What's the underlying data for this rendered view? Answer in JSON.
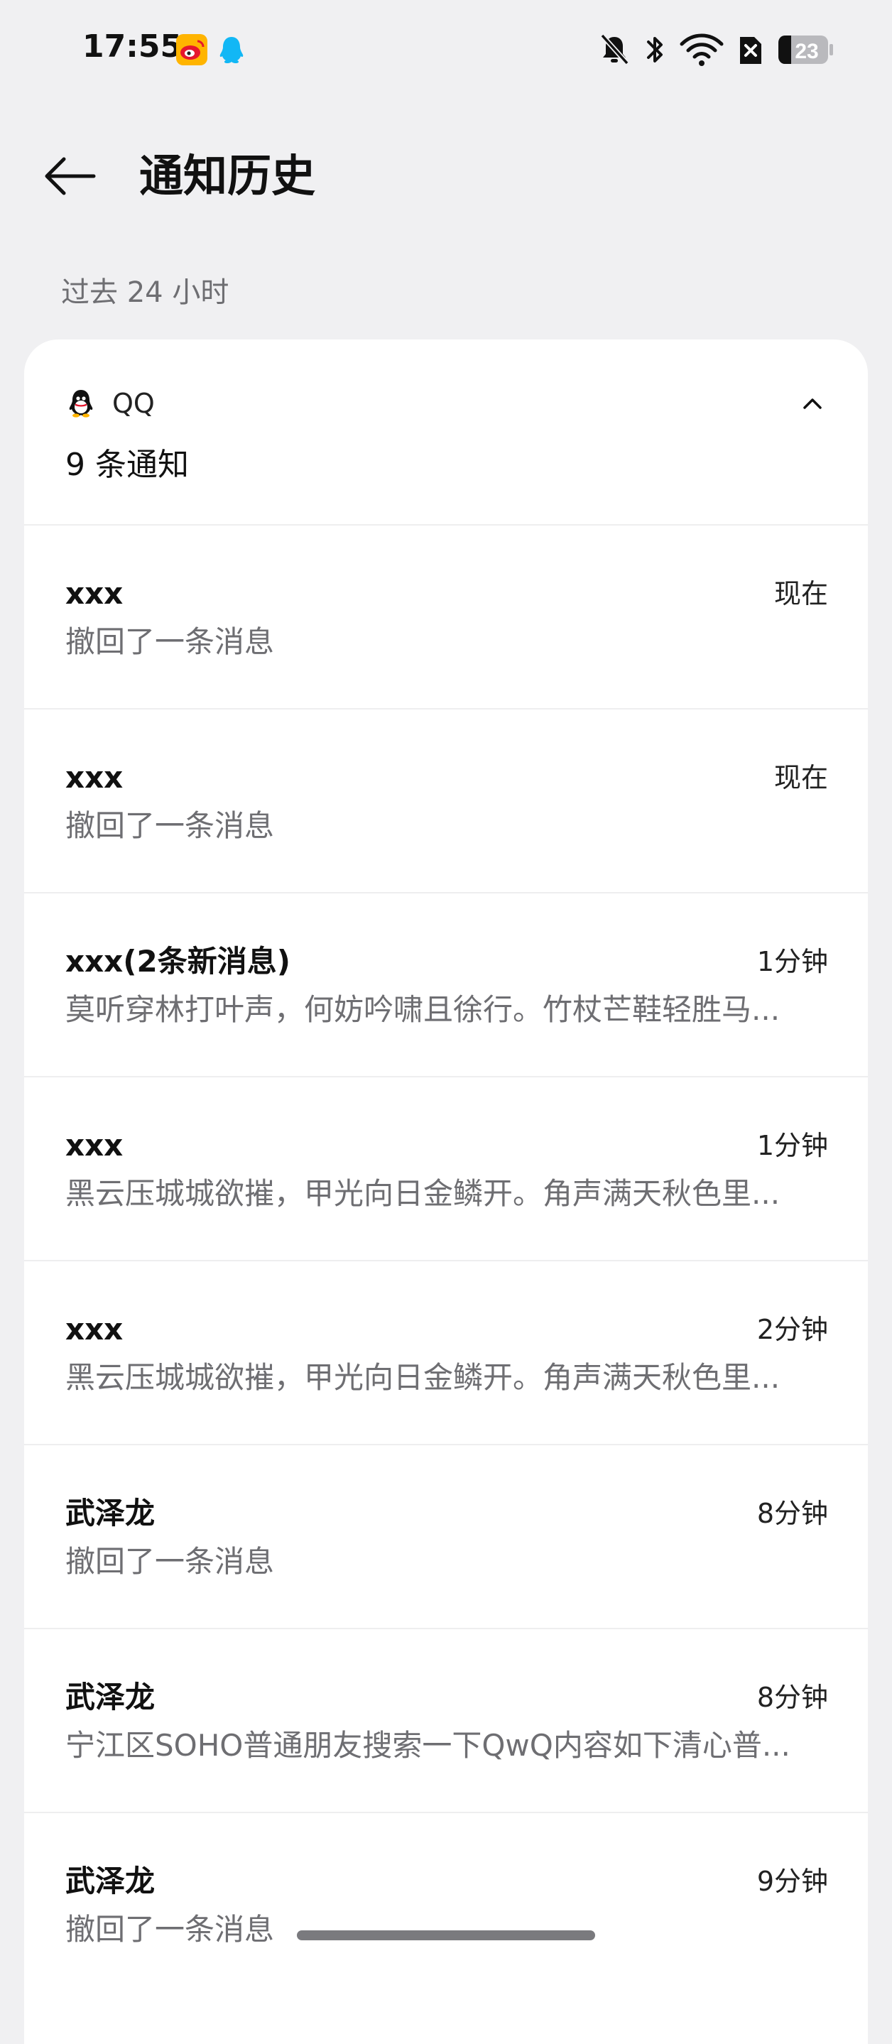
{
  "status_bar": {
    "time": "17:55",
    "app_icons": [
      "weibo-icon",
      "qq-icon"
    ],
    "right_icons": [
      "bell-muted-icon",
      "bluetooth-icon",
      "wifi-icon",
      "no-sim-icon",
      "battery-icon"
    ],
    "battery_level": "23"
  },
  "header": {
    "title": "通知历史"
  },
  "section": {
    "label": "过去 24 小时"
  },
  "group": {
    "app_name": "QQ",
    "count_label": "9 条通知",
    "notifications": [
      {
        "title": "xxx",
        "time": "现在",
        "body": "撤回了一条消息"
      },
      {
        "title": "xxx",
        "time": "现在",
        "body": "撤回了一条消息"
      },
      {
        "title": "xxx(2条新消息)",
        "time": "1分钟",
        "body": "莫听穿林打叶声，何妨吟啸且徐行。竹杖芒鞋轻胜马..."
      },
      {
        "title": "xxx",
        "time": "1分钟",
        "body": "黑云压城城欲摧，甲光向日金鳞开。角声满天秋色里..."
      },
      {
        "title": "xxx",
        "time": "2分钟",
        "body": "黑云压城城欲摧，甲光向日金鳞开。角声满天秋色里..."
      },
      {
        "title": "武泽龙",
        "time": "8分钟",
        "body": "撤回了一条消息"
      },
      {
        "title": "武泽龙",
        "time": "8分钟",
        "body": "宁江区SOHO普通朋友搜索一下QwQ内容如下清心普..."
      },
      {
        "title": "武泽龙",
        "time": "9分钟",
        "body": "撤回了一条消息"
      }
    ]
  },
  "colors": {
    "background": "#f0f0f2",
    "card": "#ffffff",
    "secondary_text": "#6e6e72",
    "qq_blue": "#12b7f5",
    "weibo_red": "#e6162d"
  }
}
